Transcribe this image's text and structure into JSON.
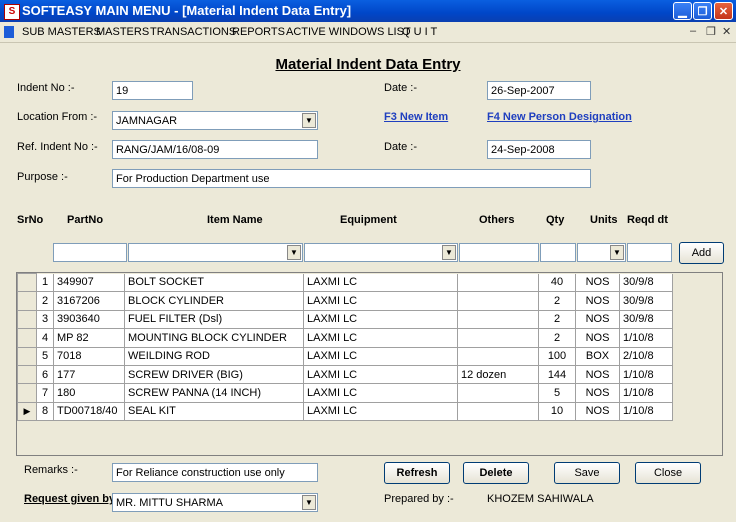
{
  "window": {
    "title": "SOFTEASY MAIN MENU - [Material Indent Data Entry]",
    "app_icon": "S"
  },
  "menu": [
    "SUB MASTERS",
    "MASTERS",
    "TRANSACTIONS",
    "REPORTS",
    "ACTIVE WINDOWS LIST",
    "Q U I T"
  ],
  "form": {
    "heading": "Material Indent Data Entry",
    "indent_no_label": "Indent No :-",
    "indent_no": "19",
    "date1_label": "Date :-",
    "date1": "26-Sep-2007",
    "location_label": "Location From :-",
    "location": "JAMNAGAR",
    "f3_link": "F3 New Item",
    "f4_link": "F4 New Person Designation",
    "ref_label": "Ref. Indent No :-",
    "ref_no": "RANG/JAM/16/08-09",
    "date2_label": "Date :-",
    "date2": "24-Sep-2008",
    "purpose_label": "Purpose :-",
    "purpose": "For Production Department use"
  },
  "columns": [
    "SrNo",
    "PartNo",
    "Item Name",
    "Equipment",
    "Others",
    "Qty",
    "Units",
    "Reqd dt"
  ],
  "add_label": "Add",
  "rows": [
    {
      "sr": "1",
      "part": "349907",
      "item": "BOLT SOCKET",
      "equip": "LAXMI LC",
      "others": "",
      "qty": "40",
      "units": "NOS",
      "reqd": "30/9/8"
    },
    {
      "sr": "2",
      "part": "3167206",
      "item": "BLOCK CYLINDER",
      "equip": "LAXMI LC",
      "others": "",
      "qty": "2",
      "units": "NOS",
      "reqd": "30/9/8"
    },
    {
      "sr": "3",
      "part": "3903640",
      "item": "FUEL FILTER (Dsl)",
      "equip": "LAXMI LC",
      "others": "",
      "qty": "2",
      "units": "NOS",
      "reqd": "30/9/8"
    },
    {
      "sr": "4",
      "part": "MP 82",
      "item": "MOUNTING BLOCK CYLINDER",
      "equip": "LAXMI LC",
      "others": "",
      "qty": "2",
      "units": "NOS",
      "reqd": "1/10/8"
    },
    {
      "sr": "5",
      "part": "7018",
      "item": "WEILDING ROD",
      "equip": "LAXMI LC",
      "others": "",
      "qty": "100",
      "units": "BOX",
      "reqd": "2/10/8"
    },
    {
      "sr": "6",
      "part": "177",
      "item": "SCREW DRIVER (BIG)",
      "equip": "LAXMI LC",
      "others": "12 dozen",
      "qty": "144",
      "units": "NOS",
      "reqd": "1/10/8"
    },
    {
      "sr": "7",
      "part": "180",
      "item": "SCREW PANNA (14 INCH)",
      "equip": "LAXMI LC",
      "others": "",
      "qty": "5",
      "units": "NOS",
      "reqd": "1/10/8"
    },
    {
      "sr": "8",
      "part": "TD00718/40",
      "item": "SEAL KIT",
      "equip": "LAXMI LC",
      "others": "",
      "qty": "10",
      "units": "NOS",
      "reqd": "1/10/8"
    }
  ],
  "footer": {
    "remarks_label": "Remarks :-",
    "remarks": "For Reliance construction use only",
    "request_label": "Request given by",
    "request_by": "MR. MITTU SHARMA",
    "prepared_label": "Prepared by :-",
    "prepared_by": "KHOZEM SAHIWALA",
    "refresh": "Refresh",
    "delete": "Delete",
    "save": "Save",
    "close": "Close"
  }
}
